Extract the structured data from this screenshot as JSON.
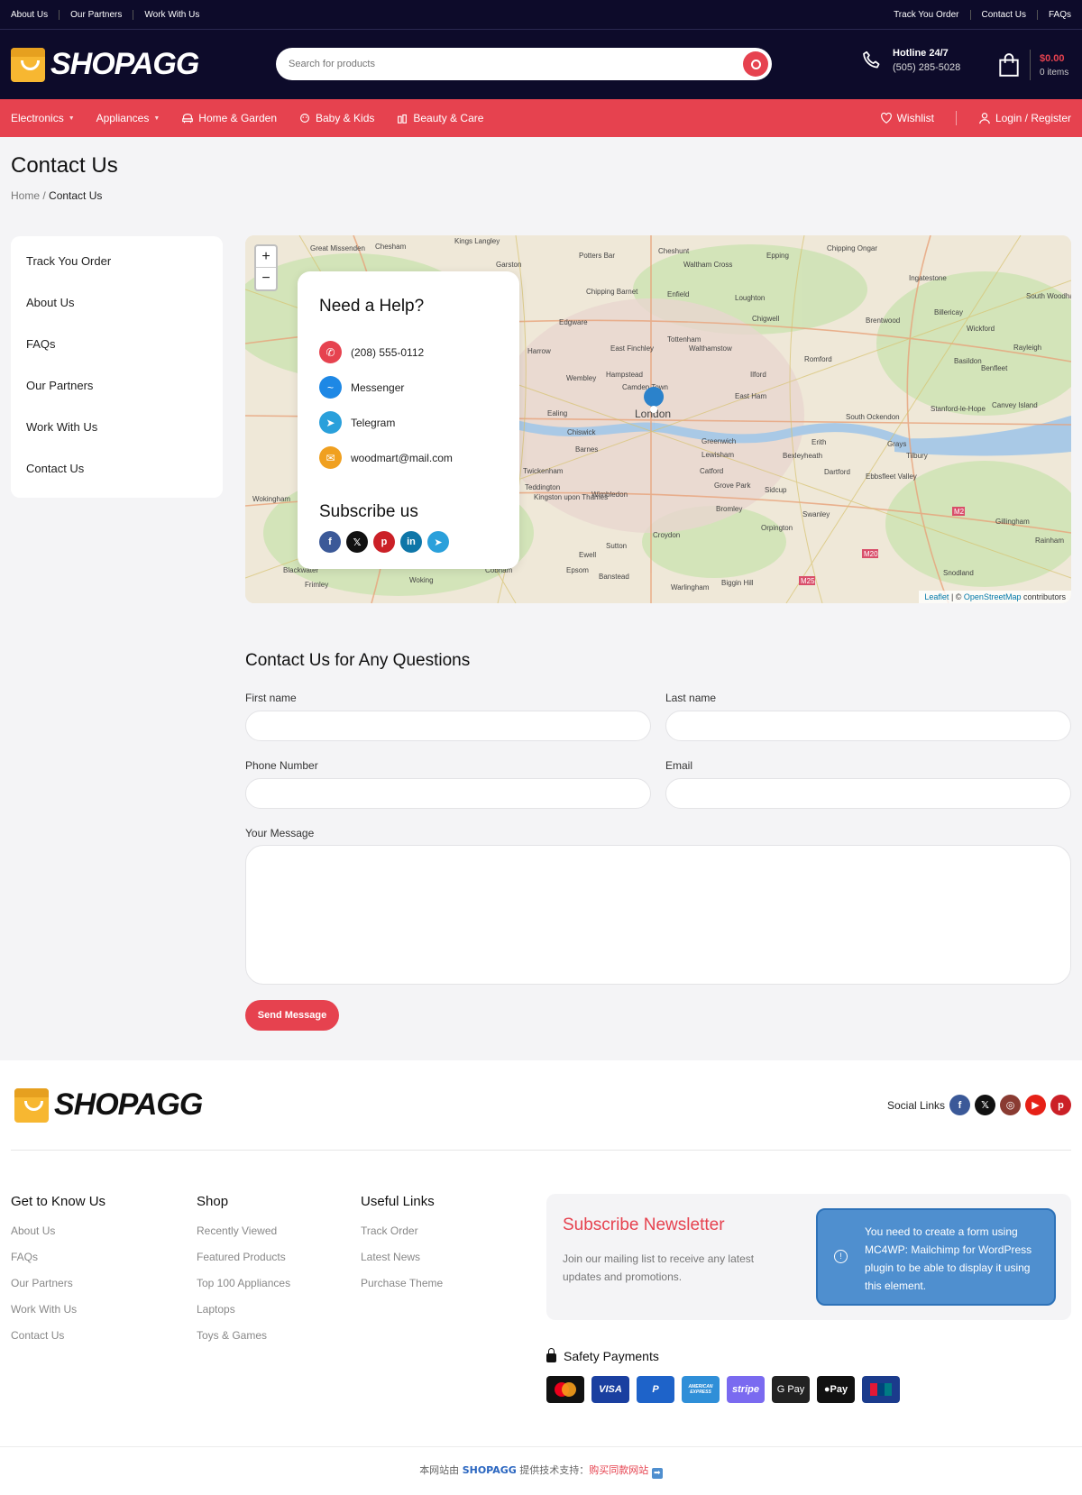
{
  "topbar": {
    "left": [
      "About Us",
      "Our Partners",
      "Work With Us"
    ],
    "right": [
      "Track You Order",
      "Contact Us",
      "FAQs"
    ]
  },
  "header": {
    "logo": "SHOPAGG",
    "search_placeholder": "Search for products",
    "hotline_label": "Hotline 24/7",
    "hotline_number": "(505) 285-5028",
    "cart_total": "$0.00",
    "cart_items": "0 items"
  },
  "nav": {
    "items": [
      "Electronics",
      "Appliances",
      "Home & Garden",
      "Baby & Kids",
      "Beauty & Care"
    ],
    "wishlist": "Wishlist",
    "login": "Login / Register"
  },
  "page": {
    "title": "Contact Us",
    "breadcrumb_home": "Home",
    "breadcrumb_current": "Contact Us"
  },
  "sidebar": {
    "items": [
      "Track You Order",
      "About Us",
      "FAQs",
      "Our Partners",
      "Work With Us",
      "Contact Us"
    ]
  },
  "map": {
    "zoom_in": "+",
    "zoom_out": "−",
    "attribution_leaflet": "Leaflet",
    "attribution_sep": " | © ",
    "attribution_osm": "OpenStreetMap",
    "attribution_tail": " contributors",
    "places": [
      "Potters Bar",
      "Cheshunt",
      "Epping",
      "Chipping Ongar",
      "Waltham Cross",
      "Enfield",
      "Chipping Barnet",
      "Loughton",
      "Ingatestone",
      "Edgware",
      "Chigwell",
      "Brentwood",
      "Billericay",
      "Harrow",
      "East Finchley",
      "Tottenham",
      "Walthamstow",
      "Romford",
      "Wickford",
      "Basildon",
      "Wembley",
      "Hampstead",
      "Camden Town",
      "Ilford",
      "East Ham",
      "Rayleigh",
      "Benfleet",
      "Ealing",
      "London",
      "South Ockendon",
      "Stanford-le-Hope",
      "Canvey Island",
      "Chiswick",
      "Greenwich",
      "Erith",
      "Grays",
      "Barnes",
      "Lewisham",
      "Bexleyheath",
      "Tilbury",
      "Twickenham",
      "Catford",
      "Dartford",
      "Ebbsfleet Valley",
      "Teddington",
      "Kingston upon Thames",
      "Wimbledon",
      "Grove Park",
      "Sidcup",
      "Bromley",
      "Swanley",
      "Orpington",
      "Gillingham",
      "Croydon",
      "Sutton",
      "Ewell",
      "Epsom",
      "Banstead",
      "Biggin Hill",
      "Warlingham",
      "Woking",
      "Cobham",
      "Blackwater",
      "Frimley",
      "Wokingham",
      "Kings Langley",
      "Garston",
      "Great Missenden",
      "Chesham",
      "Snodland",
      "Rainham",
      "South Woodham Ferrers"
    ],
    "roads": [
      "M2",
      "M20",
      "M25"
    ]
  },
  "help": {
    "title": "Need a Help?",
    "contacts": [
      {
        "icon": "phone-icon",
        "label": "(208) 555-0112",
        "color": "#e6424f"
      },
      {
        "icon": "messenger-icon",
        "label": "Messenger",
        "color": "#1e88e5"
      },
      {
        "icon": "telegram-icon",
        "label": "Telegram",
        "color": "#2aa0db"
      },
      {
        "icon": "email-icon",
        "label": "woodmart@mail.com",
        "color": "#f0a020"
      }
    ],
    "subscribe_title": "Subscribe us"
  },
  "form": {
    "title": "Contact Us for Any Questions",
    "first_name": "First name",
    "last_name": "Last name",
    "phone": "Phone Number",
    "email": "Email",
    "message": "Your Message",
    "send": "Send Message"
  },
  "footer": {
    "logo": "SHOPAGG",
    "social_label": "Social Links",
    "columns": [
      {
        "title": "Get to Know Us",
        "links": [
          "About Us",
          "FAQs",
          "Our Partners",
          "Work With Us",
          "Contact Us"
        ]
      },
      {
        "title": "Shop",
        "links": [
          "Recently Viewed",
          "Featured Products",
          "Top 100 Appliances",
          "Laptops",
          "Toys & Games"
        ]
      },
      {
        "title": "Useful Links",
        "links": [
          "Track Order",
          "Latest News",
          "Purchase Theme"
        ]
      }
    ],
    "newsletter_title": "Subscribe Newsletter",
    "newsletter_text": "Join our mailing list to receive any latest updates and promotions.",
    "notice": "You need to create a form using MC4WP: Mailchimp for WordPress plugin to be able to display it using this element.",
    "safety_title": "Safety Payments",
    "payments": [
      "VISA",
      "P",
      "AMERICAN EXPRESS",
      "stripe",
      "G Pay",
      "Pay"
    ],
    "copy_pre": "本网站由 ",
    "copy_brand": "SHOPAGG",
    "copy_mid": " 提供技术支持：",
    "copy_link": "购买同款网站",
    "copy_arrow": "➡"
  },
  "colors": {
    "accent": "#e6424f",
    "dark": "#0d0b2a"
  }
}
